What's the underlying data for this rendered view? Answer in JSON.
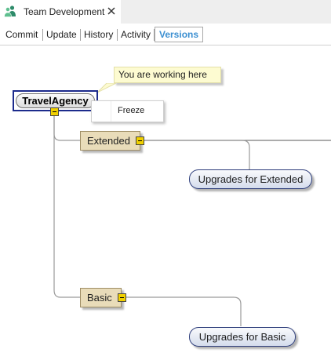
{
  "window": {
    "tab_title": "Team Development",
    "tab_icon": "team-users-icon",
    "close_icon": "close-icon"
  },
  "toolbar": {
    "items": [
      {
        "label": "Commit"
      },
      {
        "label": "Update"
      },
      {
        "label": "History"
      },
      {
        "label": "Activity"
      },
      {
        "label": "Versions"
      }
    ],
    "active": "Versions"
  },
  "diagram": {
    "tooltip": "You are working here",
    "root": {
      "label": "TravelAgency"
    },
    "context_menu": {
      "items": [
        {
          "label": "Freeze"
        }
      ]
    },
    "versions": [
      {
        "label": "Extended",
        "upgrade_label": "Upgrades for Extended"
      },
      {
        "label": "Basic",
        "upgrade_label": "Upgrades for Basic"
      }
    ]
  },
  "colors": {
    "accent": "#3b8fd1",
    "version_fill": "#e9dcb9",
    "collapse_button": "#f0d000",
    "selection_border": "#1c2b8c",
    "tooltip_fill": "#fdfbd1"
  }
}
